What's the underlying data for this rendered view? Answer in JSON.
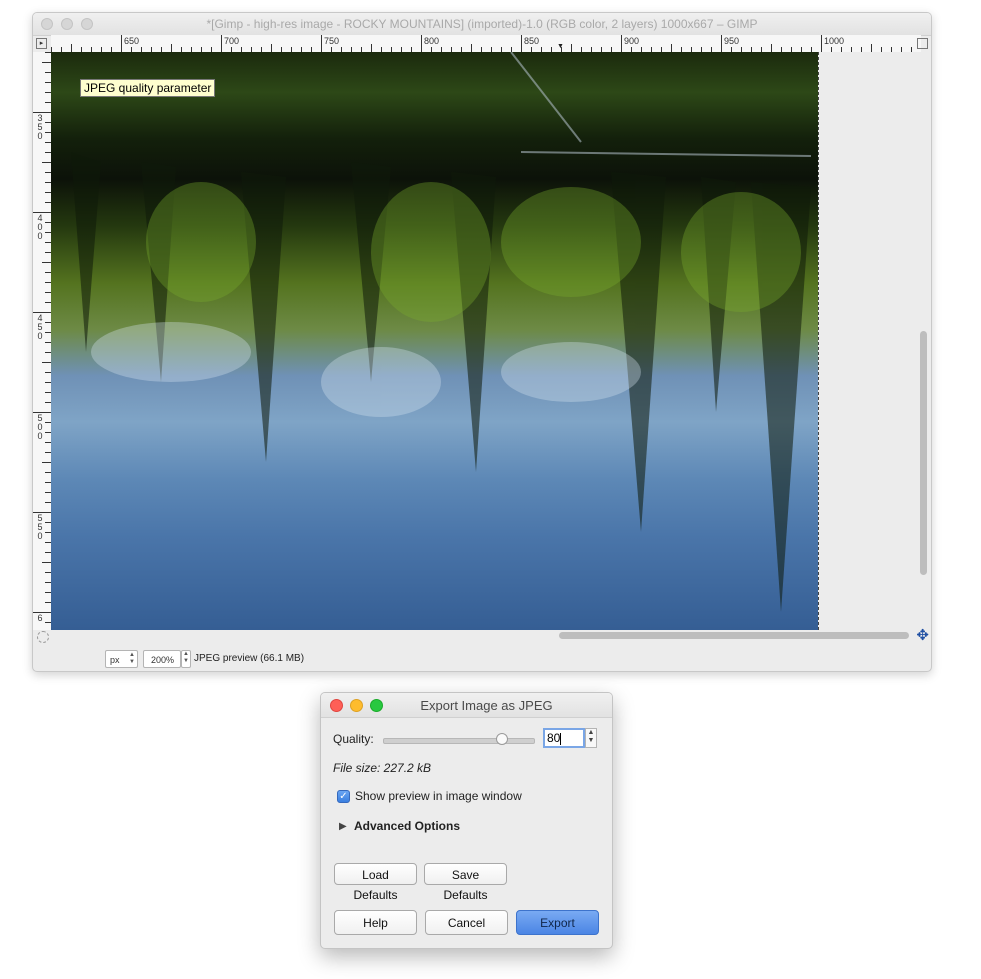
{
  "gimp_window": {
    "title": "*[Gimp - high-res image - ROCKY MOUNTAINS] (imported)-1.0 (RGB color, 2 layers) 1000x667 – GIMP",
    "ruler_top_labels": [
      "650",
      "700",
      "750",
      "800",
      "850",
      "900",
      "950",
      "1000"
    ],
    "ruler_left_labels": [
      "350",
      "400",
      "450",
      "500",
      "550",
      "6"
    ],
    "tooltip": "JPEG quality parameter",
    "statusbar": {
      "unit": "px",
      "zoom": "200%",
      "message": "JPEG preview (66.1 MB)"
    }
  },
  "export_dialog": {
    "title": "Export Image as JPEG",
    "quality_label": "Quality:",
    "quality_value": "80",
    "quality_fraction": 0.8,
    "file_size": "File size: 227.2 kB",
    "show_preview_label": "Show preview in image window",
    "show_preview_checked": true,
    "advanced_options_label": "Advanced Options",
    "load_defaults_label": "Load Defaults",
    "save_defaults_label": "Save Defaults",
    "help_label": "Help",
    "cancel_label": "Cancel",
    "export_label": "Export"
  },
  "colors": {
    "accent": "#4b85e4",
    "tooltip_bg": "#ffffcf",
    "close": "#fe5f57",
    "minimize": "#febc2e",
    "zoom": "#28c840"
  }
}
